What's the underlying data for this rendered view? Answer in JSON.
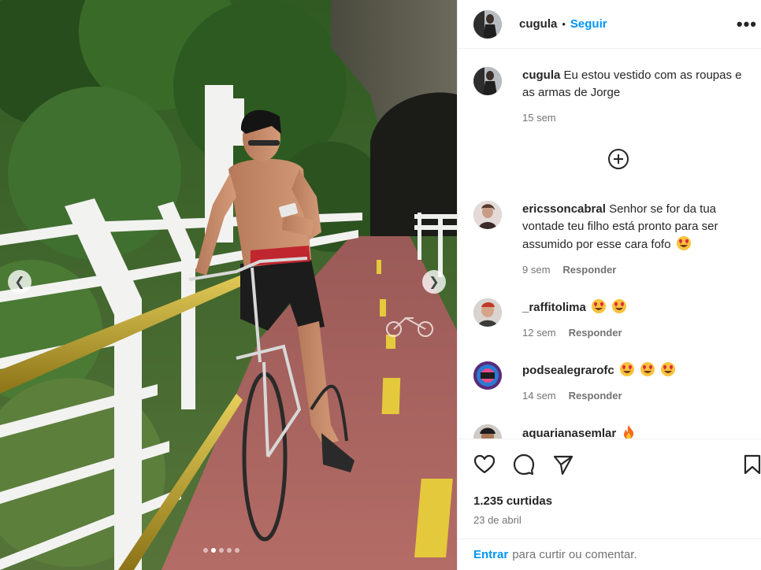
{
  "post": {
    "username": "cugula",
    "follow_label": "Seguir",
    "separator": "•",
    "more_icon": "more-horizontal-icon"
  },
  "caption": {
    "username": "cugula",
    "text": "Eu estou vestido com as roupas e as armas de Jorge",
    "time": "15 sem"
  },
  "load_more_icon": "plus-circle-icon",
  "comments": [
    {
      "username": "ericssoncabral",
      "text": "Senhor se for da tua vontade teu filho está pronto para ser assumido por esse cara fofo",
      "emoji": [
        "heart-eyes"
      ],
      "time": "9 sem",
      "reply": "Responder"
    },
    {
      "username": "_raffitolima",
      "text": "",
      "emoji": [
        "heart-eyes",
        "heart-eyes"
      ],
      "time": "12 sem",
      "reply": "Responder"
    },
    {
      "username": "podsealegrarofc",
      "text": "",
      "emoji": [
        "heart-eyes",
        "heart-eyes",
        "heart-eyes"
      ],
      "time": "14 sem",
      "reply": "Responder"
    },
    {
      "username": "aquarianasemlar",
      "text": "",
      "emoji": [
        "fire"
      ],
      "time": "",
      "reply": ""
    }
  ],
  "actions": {
    "icons": [
      "heart-icon",
      "comment-icon",
      "share-icon",
      "bookmark-icon"
    ],
    "likes": "1.235 curtidas",
    "date": "23 de abril"
  },
  "login": {
    "enter_label": "Entrar",
    "rest": "para curtir ou comentar."
  },
  "carousel": {
    "slide_count": 4,
    "active_index": 1,
    "prev_icon": "chevron-left-icon",
    "next_icon": "chevron-right-icon"
  }
}
